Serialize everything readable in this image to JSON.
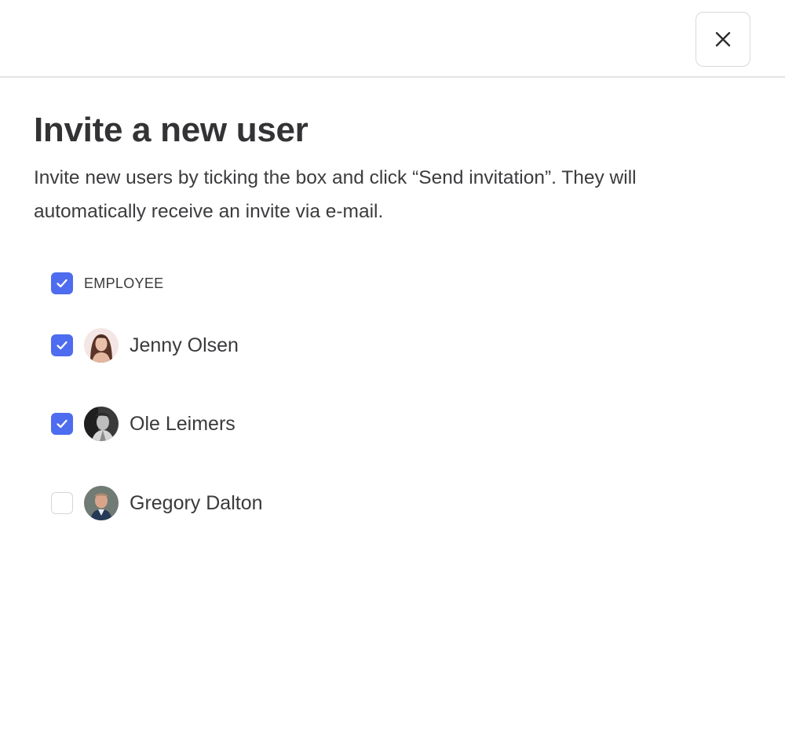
{
  "header": {
    "close_icon": "close-icon"
  },
  "main": {
    "title": "Invite a new user",
    "description_line1": "Invite new users by ticking the box and click “Send invitation”. They will",
    "description_line2": "automatically receive an invite via e-mail."
  },
  "group": {
    "label": "EMPLOYEE",
    "checked": true
  },
  "users": [
    {
      "name": "Jenny Olsen",
      "checked": true
    },
    {
      "name": "Ole Leimers",
      "checked": true
    },
    {
      "name": "Gregory Dalton",
      "checked": false
    }
  ],
  "colors": {
    "accent": "#4d6cf0",
    "text": "#3a3a3d",
    "border": "#d9d9dc"
  }
}
